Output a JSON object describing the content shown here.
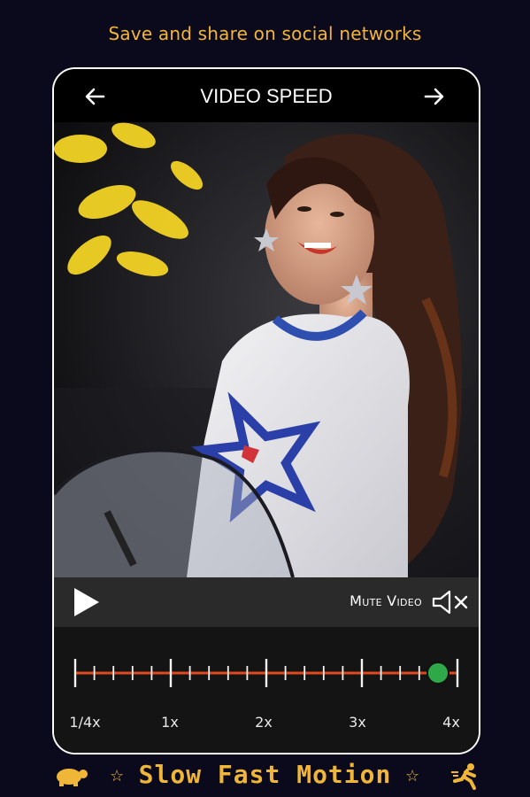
{
  "tagline": "Save and share on social networks",
  "screen": {
    "title": "VIDEO SPEED"
  },
  "player": {
    "mute_label": "Mute Video"
  },
  "speed": {
    "labels": [
      "1/4x",
      "1x",
      "2x",
      "3x",
      "4x"
    ],
    "selected": "4x",
    "selected_fraction": 1.0
  },
  "brand": {
    "name": "Slow Fast Motion"
  },
  "colors": {
    "accent": "#f2b53a",
    "track": "#e0481f",
    "thumb": "#2fa84a",
    "background": "#0b0a1c"
  },
  "icons": [
    "back-arrow-icon",
    "forward-arrow-icon",
    "play-icon",
    "mute-speaker-icon",
    "turtle-icon",
    "star-icon",
    "runner-icon"
  ]
}
